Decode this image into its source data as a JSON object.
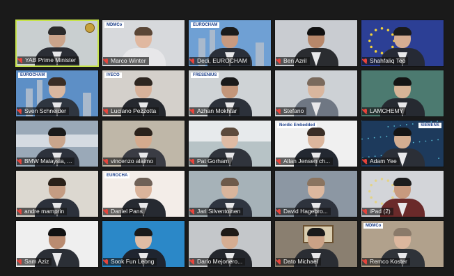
{
  "participants": [
    {
      "name": "YAB Prime Minister",
      "bg": "#c9cfd0",
      "body": "#2b2e35",
      "skin": "#caa48b",
      "hair": "#2a2a2a",
      "active": true,
      "extra": "seal"
    },
    {
      "name": "Marco Winter",
      "bg": "#d7d9dc",
      "body": "#e7e7e9",
      "skin": "#e0b8a0",
      "hair": "#5a4636",
      "badge": "MDMCo",
      "extra": "scene"
    },
    {
      "name": "Dedi, EUROCHAM",
      "bg": "#6fa0d4",
      "body": "#2a2f39",
      "skin": "#c89a80",
      "hair": "#1b1b1b",
      "badge": "EUROCHAM",
      "extra": "towers"
    },
    {
      "name": "Ben Azril",
      "bg": "#c9ccd1",
      "body": "#2a2c30",
      "skin": "#b7876a",
      "hair": "#111111"
    },
    {
      "name": "Shahfaliq Teo",
      "bg": "#2c3f95",
      "body": "#262a35",
      "skin": "#d5ad92",
      "hair": "#1b1b1b",
      "extra": "eu"
    },
    {
      "name": "Sven Schneider",
      "bg": "#5d8fc6",
      "body": "#2f3640",
      "skin": "#d9b7a0",
      "hair": "#3a2d25",
      "badge": "EUROCHAM",
      "extra": "towers"
    },
    {
      "name": "Luciano Pezzotta",
      "bg": "#d4d0cb",
      "body": "#25282e",
      "skin": "#d8b29a",
      "hair": "#2e2620",
      "badge": "IVECO",
      "extra": "scene"
    },
    {
      "name": "Azhan Mokhtar",
      "bg": "#cfd3d6",
      "body": "#2c313a",
      "skin": "#c3967a",
      "hair": "#1a1a1a",
      "badge": "FRESENIUS",
      "extra": "scene"
    },
    {
      "name": "Stefano",
      "bg": "#cdd1d5",
      "body": "#6f7783",
      "skin": "#d9b69e",
      "hair": "#7a6a5d"
    },
    {
      "name": "LAMCHEMY",
      "bg": "#4c7a70",
      "body": "#262a31",
      "skin": "#d6b396",
      "hair": "#141414"
    },
    {
      "name": "BMW Malaysia, ...",
      "bg": "#9aa9b8",
      "body": "#2d323c",
      "skin": "#c9a58c",
      "hair": "#1a1a1a",
      "extra": "cars"
    },
    {
      "name": "vincenzo alaimo",
      "bg": "#bfb7a8",
      "body": "#3a3c44",
      "skin": "#d5ab8e",
      "hair": "#2b221b"
    },
    {
      "name": "Pat Gorham",
      "bg": "#b7c3c6",
      "body": "#30343c",
      "skin": "#dfbba4",
      "hair": "#5d4a3c",
      "extra": "factory"
    },
    {
      "name": "Allan Jensen ch...",
      "bg": "#f0f0f0",
      "body": "#232831",
      "skin": "#dbb69d",
      "hair": "#3a2e26",
      "badge": "Nordic Embedded",
      "extra": "scene"
    },
    {
      "name": "Adam Yee",
      "bg": "#1d3a5c",
      "body": "#2b2f37",
      "skin": "#d4ae91",
      "hair": "#151515",
      "badge": "SIEMENS",
      "right": true,
      "extra": "stars"
    },
    {
      "name": "andre mamprin",
      "bg": "#dcd8d0",
      "body": "#2c313b",
      "skin": "#c49c82",
      "hair": "#2a2119"
    },
    {
      "name": "Daniel Pans",
      "bg": "#f3ede8",
      "body": "#262a31",
      "skin": "#dbb49b",
      "hair": "#6f6157",
      "badge": "EUROCHA",
      "extra": "scene"
    },
    {
      "name": "Jari Silventoinen",
      "bg": "#a6b2b8",
      "body": "#2f3540",
      "skin": "#d9b59c",
      "hair": "#6e5a4a"
    },
    {
      "name": "David Hagebro...",
      "bg": "#8c97a3",
      "body": "#2e333d",
      "skin": "#dcb89f",
      "hair": "#8a7460"
    },
    {
      "name": "iPad (2)",
      "bg": "#d3d5d9",
      "body": "#6a2a2a",
      "skin": "#c89a7e",
      "hair": "#1d1d1d",
      "extra": "eu-small"
    },
    {
      "name": "Sam Aziz",
      "bg": "#efefef",
      "body": "#2b2f36",
      "skin": "#b98b70",
      "hair": "#121212"
    },
    {
      "name": "Sook Fun Leong",
      "bg": "#2b88c8",
      "body": "#1f2530",
      "skin": "#dfbca4",
      "hair": "#1a1a1a",
      "extra": "scene"
    },
    {
      "name": "Dario Mejonero...",
      "bg": "#c4c7ca",
      "body": "#24272d",
      "skin": "#d5ad92",
      "hair": "#1e1a17"
    },
    {
      "name": "Dato Michael",
      "bg": "#8a7f70",
      "body": "#2a2d33",
      "skin": "#cba286",
      "hair": "#1a1a1a",
      "extra": "frame"
    },
    {
      "name": "Remco Koster",
      "bg": "#b1a18c",
      "body": "#2f3339",
      "skin": "#dcb79e",
      "hair": "#8a7a6a",
      "badge": "MDMCo",
      "extra": "scene"
    }
  ]
}
